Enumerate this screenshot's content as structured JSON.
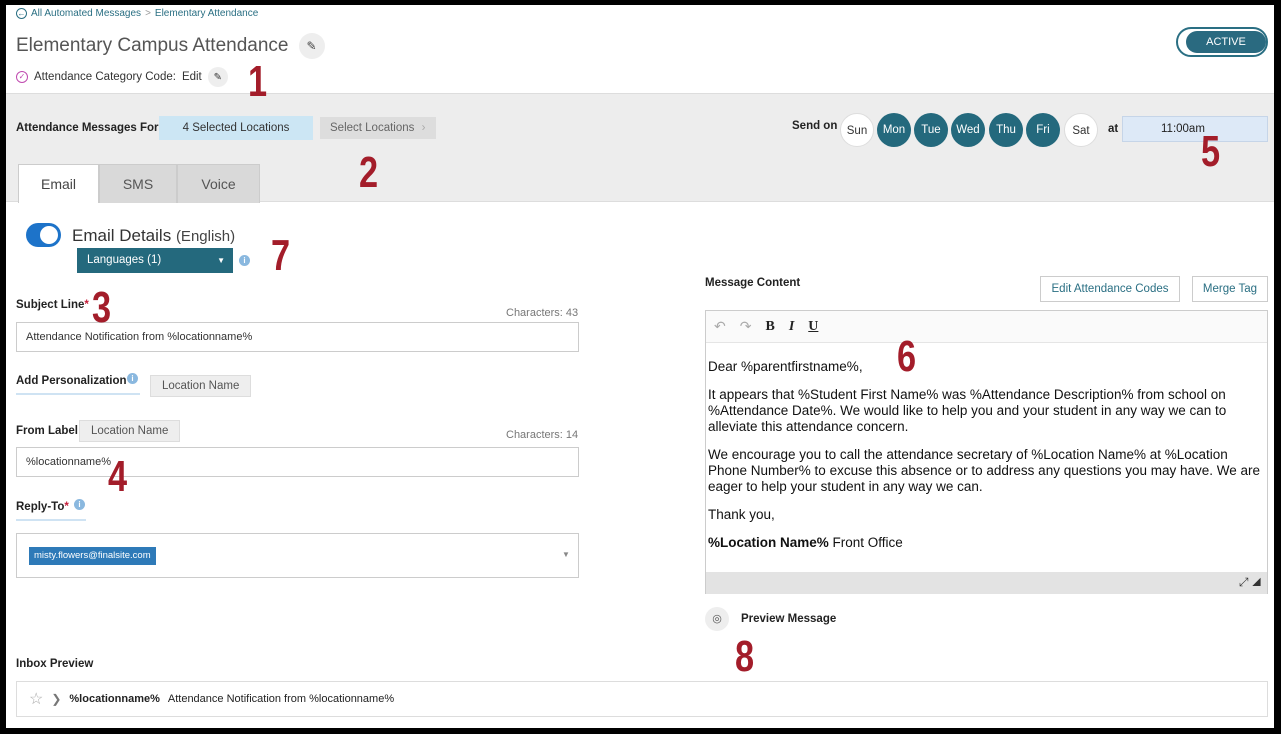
{
  "breadcrumb": {
    "root": "All Automated Messages",
    "separator": ">",
    "current": "Elementary Attendance"
  },
  "title": "Elementary Campus Attendance",
  "category": {
    "label": "Attendance Category Code:",
    "edit": "Edit"
  },
  "status_toggle": "ACTIVE",
  "locations": {
    "label": "Attendance Messages For",
    "selected": "4 Selected Locations",
    "button": "Select Locations",
    "chevron": "›"
  },
  "schedule": {
    "send_on_label": "Send on",
    "days": [
      {
        "label": "Sun",
        "active": false
      },
      {
        "label": "Mon",
        "active": true
      },
      {
        "label": "Tue",
        "active": true
      },
      {
        "label": "Wed",
        "active": true
      },
      {
        "label": "Thu",
        "active": true
      },
      {
        "label": "Fri",
        "active": true
      },
      {
        "label": "Sat",
        "active": false
      }
    ],
    "at_label": "at",
    "time": "11:00am"
  },
  "tabs": [
    {
      "label": "Email",
      "active": true
    },
    {
      "label": "SMS",
      "active": false
    },
    {
      "label": "Voice",
      "active": false
    }
  ],
  "email_details": {
    "title": "Email Details",
    "language_note": "(English)",
    "enabled": true,
    "languages_button": "Languages (1)"
  },
  "subject": {
    "label": "Subject Line",
    "required_mark": "*",
    "chars": "Characters: 43",
    "value": "Attendance Notification from %locationname%"
  },
  "personalization": {
    "label": "Add Personalization",
    "pill": "Location Name"
  },
  "from_label": {
    "label": "From Label",
    "pill": "Location Name",
    "chars": "Characters: 14",
    "value": "%locationname%"
  },
  "reply_to": {
    "label": "Reply-To",
    "required_mark": "*",
    "email": "misty.flowers@finalsite.com"
  },
  "message": {
    "label": "Message Content",
    "edit_codes_button": "Edit Attendance Codes",
    "merge_tag_button": "Merge Tag",
    "greeting": "Dear %parentfirstname%,",
    "para1": "It appears that %Student First Name% was %Attendance Description% from school on %Attendance Date%.  We would like to help you and your student in any way we can to alleviate this attendance concern.",
    "para2": "We encourage you to call the attendance secretary of %Location Name% at %Location Phone Number% to excuse this absence or to address any questions you may have.  We are eager to help your student in any way we can.",
    "closing": "Thank you,",
    "signature_bold": "%Location Name%",
    "signature_rest": " Front Office"
  },
  "preview": {
    "label": "Preview Message"
  },
  "inbox_preview": {
    "label": "Inbox Preview",
    "from": "%locationname%",
    "subject": "Attendance Notification from %locationname%"
  },
  "annotations": [
    "1",
    "2",
    "3",
    "4",
    "5",
    "6",
    "7",
    "8"
  ],
  "colors": {
    "brand_teal": "#24697d",
    "link": "#2a6f83",
    "annotation_red": "#a31d2a",
    "toggle_blue": "#1d73c9"
  },
  "icons": {
    "back": "circle-arrow-left-icon",
    "edit": "pencil-icon",
    "check": "check-circle-icon",
    "info": "info-icon",
    "undo": "undo-icon",
    "redo": "redo-icon",
    "resize": "resize-icon",
    "preview": "eye-icon",
    "star": "star-icon",
    "importance": "importance-marker-icon"
  }
}
